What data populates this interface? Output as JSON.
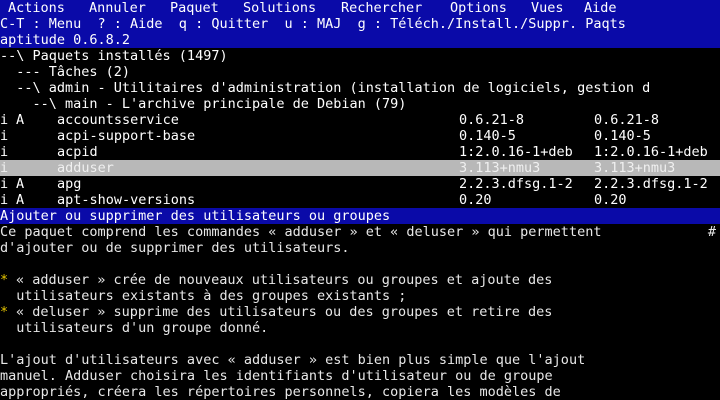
{
  "menubar": {
    "items": [
      "Actions",
      "Annuler",
      "Paquet",
      "Solutions",
      "Rechercher",
      "Options",
      "Vues",
      "Aide"
    ]
  },
  "hints": "C-T : Menu  ? : Aide  q : Quitter  u : MAJ  g : Téléch./Install./Suppr. Paqts",
  "version": "aptitude 0.6.8.2",
  "tree": [
    "--\\ Paquets installés (1497)",
    "  --- Tâches (2)",
    "  --\\ admin - Utilitaires d'administration (installation de logiciels, gestion d",
    "    --\\ main - L'archive principale de Debian (79)"
  ],
  "packages": [
    {
      "flag": "i",
      "auto": "A",
      "name": "accountsservice",
      "current": "0.6.21-8",
      "candidate": "0.6.21-8"
    },
    {
      "flag": "i",
      "auto": "",
      "name": "acpi-support-base",
      "current": "0.140-5",
      "candidate": "0.140-5"
    },
    {
      "flag": "i",
      "auto": "",
      "name": "acpid",
      "current": "1:2.0.16-1+deb",
      "candidate": "1:2.0.16-1+deb"
    },
    {
      "flag": "i",
      "auto": "",
      "name": "adduser",
      "current": "3.113+nmu3",
      "candidate": "3.113+nmu3"
    },
    {
      "flag": "i",
      "auto": "A",
      "name": "apg",
      "current": "2.2.3.dfsg.1-2",
      "candidate": "2.2.3.dfsg.1-2"
    },
    {
      "flag": "i",
      "auto": "A",
      "name": "apt-show-versions",
      "current": "0.20",
      "candidate": "0.20"
    }
  ],
  "description": {
    "title": "Ajouter ou supprimer des utilisateurs ou groupes",
    "lines": [
      "Ce paquet comprend les commandes « adduser » et « deluser » qui permettent",
      "d'ajouter ou de supprimer des utilisateurs.",
      "",
      "« adduser » crée de nouveaux utilisateurs ou groupes et ajoute des",
      "  utilisateurs existants à des groupes existants ;",
      "« deluser » supprime des utilisateurs ou des groupes et retire des",
      "  utilisateurs d'un groupe donné.",
      "",
      "L'ajout d'utilisateurs avec « adduser » est bien plus simple que l'ajout",
      "manuel. Adduser choisira les identifiants d'utilisateur ou de groupe",
      "appropriés, créera les répertoires personnels, copiera les modèles de"
    ],
    "bullet": "*",
    "scroll_marker": "#"
  },
  "colors": {
    "bar_blue": "#0a0aa8",
    "selection": "#b8b8b8",
    "bullet": "#e8c800"
  }
}
